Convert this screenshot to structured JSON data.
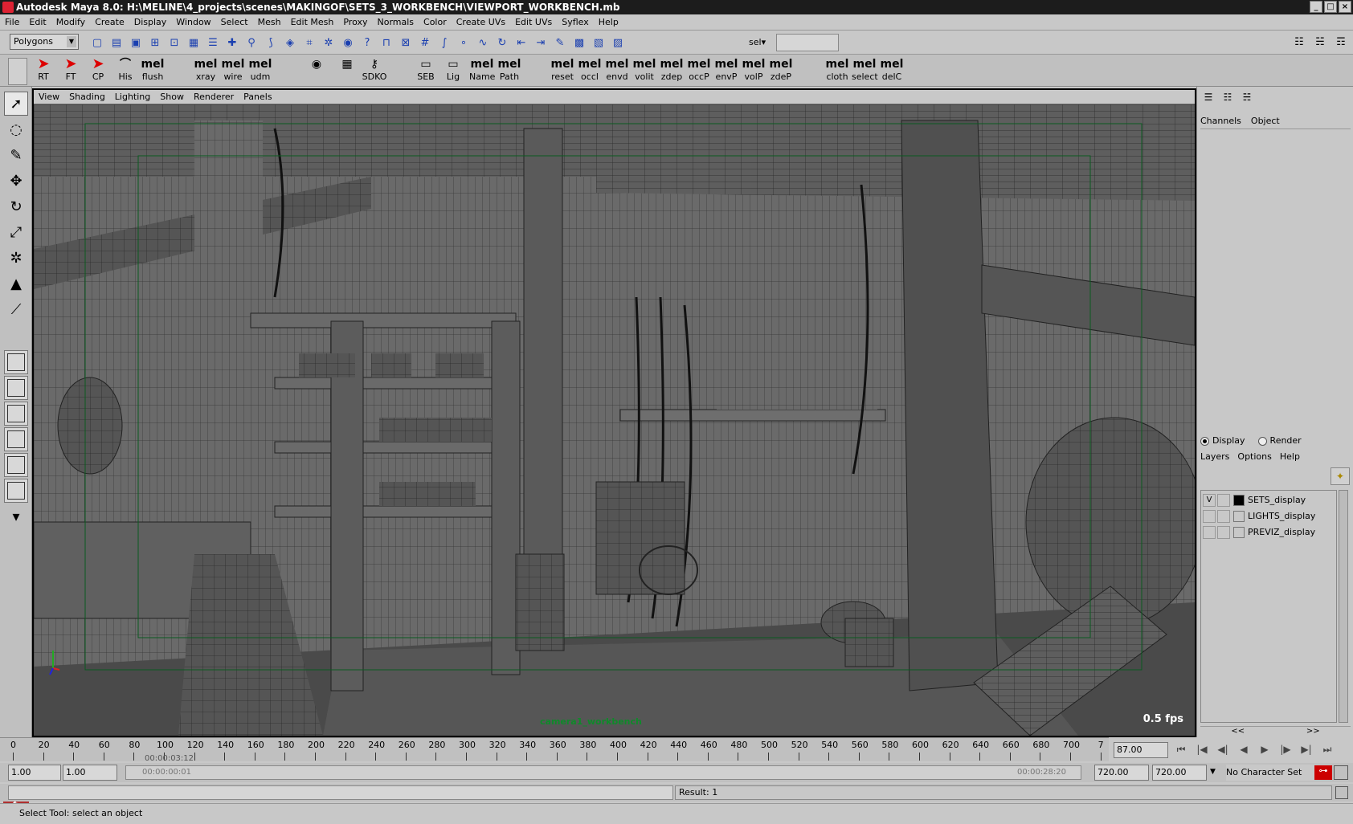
{
  "window": {
    "title": "Autodesk Maya 8.0: H:\\MELINE\\4_projects\\scenes\\MAKINGOF\\SETS_3_WORKBENCH\\VIEWPORT_WORKBENCH.mb"
  },
  "menubar": [
    "File",
    "Edit",
    "Modify",
    "Create",
    "Display",
    "Window",
    "Select",
    "Mesh",
    "Edit Mesh",
    "Proxy",
    "Normals",
    "Color",
    "Create UVs",
    "Edit UVs",
    "Syflex",
    "Help"
  ],
  "status_line": {
    "mode": "Polygons",
    "sel_label": "sel",
    "sel_value": ""
  },
  "shelf": {
    "buttons": [
      {
        "glyph": "➤",
        "label": "RT"
      },
      {
        "glyph": "➤",
        "label": "FT"
      },
      {
        "glyph": "➤",
        "label": "CP"
      },
      {
        "glyph": "⌒",
        "label": "His"
      },
      {
        "glyph": "mel",
        "label": "flush"
      },
      {
        "glyph": "mel",
        "label": "xray"
      },
      {
        "glyph": "mel",
        "label": "wire"
      },
      {
        "glyph": "mel",
        "label": "udm"
      },
      {
        "glyph": "◉",
        "label": ""
      },
      {
        "glyph": "▦",
        "label": ""
      },
      {
        "glyph": "⚷",
        "label": "SDKO"
      },
      {
        "glyph": "▭",
        "label": "SEB"
      },
      {
        "glyph": "▭",
        "label": "Lig"
      },
      {
        "glyph": "mel",
        "label": "Name"
      },
      {
        "glyph": "mel",
        "label": "Path"
      },
      {
        "glyph": "mel",
        "label": "reset"
      },
      {
        "glyph": "mel",
        "label": "occl"
      },
      {
        "glyph": "mel",
        "label": "envd"
      },
      {
        "glyph": "mel",
        "label": "volit"
      },
      {
        "glyph": "mel",
        "label": "zdep"
      },
      {
        "glyph": "mel",
        "label": "occP"
      },
      {
        "glyph": "mel",
        "label": "envP"
      },
      {
        "glyph": "mel",
        "label": "volP"
      },
      {
        "glyph": "mel",
        "label": "zdeP"
      },
      {
        "glyph": "mel",
        "label": "cloth"
      },
      {
        "glyph": "mel",
        "label": "select"
      },
      {
        "glyph": "mel",
        "label": "delC"
      }
    ]
  },
  "viewport": {
    "menu": [
      "View",
      "Shading",
      "Lighting",
      "Show",
      "Renderer",
      "Panels"
    ],
    "camera": "camera1_workbench",
    "fps": "0.5 fps"
  },
  "channel_box": {
    "tabs": [
      "Channels",
      "Object"
    ],
    "display_mode": [
      "Display",
      "Render"
    ],
    "layer_menu": [
      "Layers",
      "Options",
      "Help"
    ],
    "layers": [
      {
        "visible": "V",
        "name": "SETS_display",
        "color": "#000000"
      },
      {
        "visible": "",
        "name": "LIGHTS_display",
        "color": "#c8c8c8"
      },
      {
        "visible": "",
        "name": "PREVIZ_display",
        "color": "#c8c8c8"
      }
    ],
    "scroll_left": "<<",
    "scroll_right": ">>"
  },
  "timeline": {
    "ticks": [
      "0",
      "20",
      "40",
      "60",
      "80",
      "100",
      "120",
      "140",
      "160",
      "180",
      "200",
      "220",
      "240",
      "260",
      "280",
      "300",
      "320",
      "340",
      "360",
      "380",
      "400",
      "420",
      "440",
      "460",
      "480",
      "500",
      "520",
      "540",
      "560",
      "580",
      "600",
      "620",
      "640",
      "660",
      "680",
      "700",
      "7"
    ],
    "time_marker": "00:00:03:12",
    "current_frame": "87.00"
  },
  "range": {
    "start_time": "1.00",
    "playback_start": "1.00",
    "slider_start": "00:00:00:01",
    "slider_end": "00:00:28:20",
    "playback_end": "720.00",
    "end_time": "720.00",
    "character_set": "No Character Set"
  },
  "command_line": {
    "result": "Result: 1"
  },
  "help_line": "Select Tool: select an object"
}
